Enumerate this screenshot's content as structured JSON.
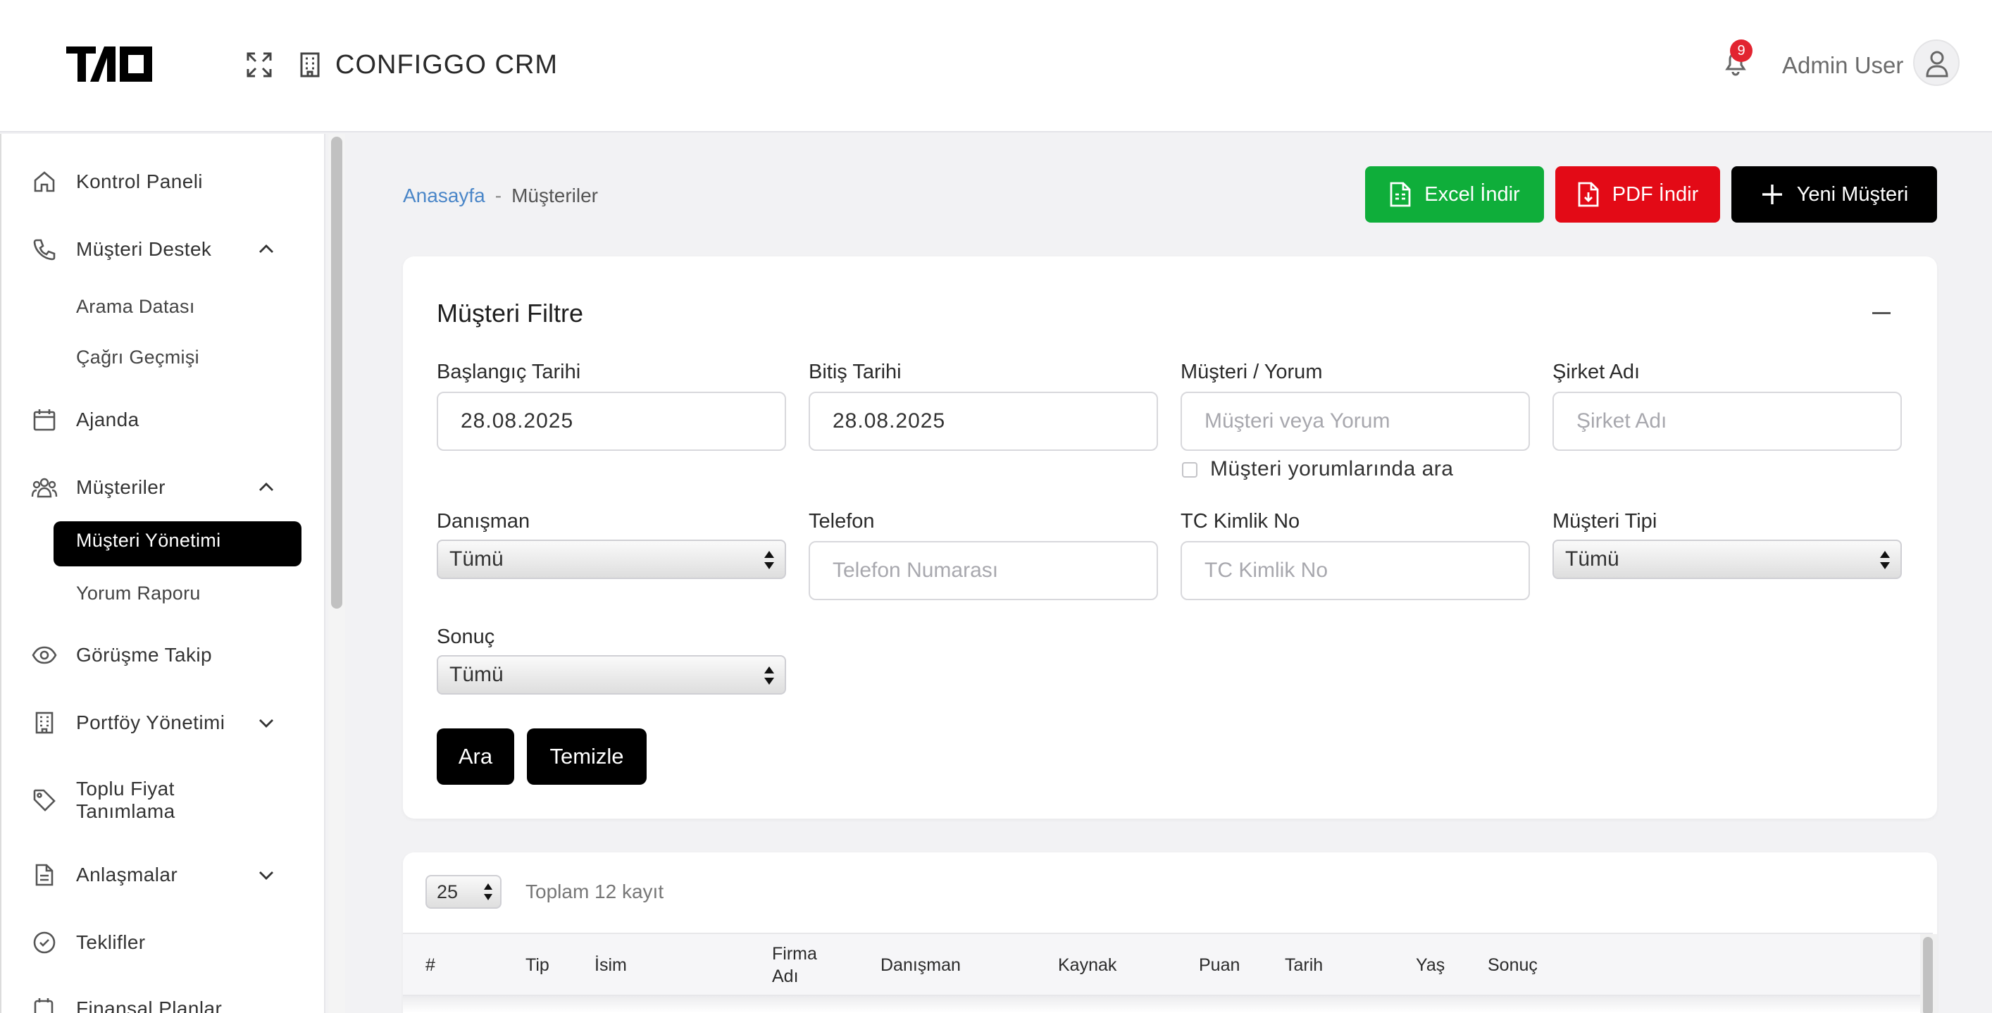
{
  "header": {
    "app_title": "CONFIGGO  CRM",
    "notification_count": "9",
    "user_name": "Admin User"
  },
  "sidebar": {
    "items": [
      {
        "label": "Kontrol Paneli",
        "icon": "home-icon"
      },
      {
        "label": "Müşteri Destek",
        "icon": "phone-icon",
        "expanded": true
      },
      {
        "label": "Ajanda",
        "icon": "calendar-icon"
      },
      {
        "label": "Müşteriler",
        "icon": "users-icon",
        "expanded": true
      },
      {
        "label": "Görüşme Takip",
        "icon": "eye-icon"
      },
      {
        "label": "Portföy Yönetimi",
        "icon": "building-icon",
        "expanded": false
      },
      {
        "label": "Toplu Fiyat\nTanımlama",
        "icon": "tag-icon"
      },
      {
        "label": "Anlaşmalar",
        "icon": "document-icon",
        "expanded": false
      },
      {
        "label": "Teklifler",
        "icon": "check-circle-icon"
      },
      {
        "label": "Finansal Planlar",
        "icon": "finance-icon"
      }
    ],
    "support_sub": [
      "Arama Datası",
      "Çağrı Geçmişi"
    ],
    "customers_sub": [
      "Müşteri Yönetimi",
      "Yorum Raporu"
    ],
    "active_sub": "Müşteri Yönetimi"
  },
  "breadcrumb": {
    "home": "Anasayfa",
    "separator": "-",
    "current": "Müşteriler"
  },
  "actions": {
    "excel": "Excel İndir",
    "pdf": "PDF İndir",
    "new": "Yeni Müşteri"
  },
  "filter": {
    "title": "Müşteri Filtre",
    "start_label": "Başlangıç Tarihi",
    "start_value": "28.08.2025",
    "end_label": "Bitiş Tarihi",
    "end_value": "28.08.2025",
    "customer_label": "Müşteri / Yorum",
    "customer_placeholder": "Müşteri veya Yorum",
    "search_comments_label": "Müşteri yorumlarında ara",
    "company_label": "Şirket Adı",
    "company_placeholder": "Şirket Adı",
    "consultant_label": "Danışman",
    "consultant_value": "Tümü",
    "phone_label": "Telefon",
    "phone_placeholder": "Telefon Numarası",
    "tc_label": "TC Kimlik No",
    "tc_placeholder": "TC Kimlik No",
    "type_label": "Müşteri Tipi",
    "type_value": "Tümü",
    "result_label": "Sonuç",
    "result_value": "Tümü",
    "search_btn": "Ara",
    "clear_btn": "Temizle"
  },
  "table": {
    "page_size": "25",
    "total_text": "Toplam 12 kayıt",
    "columns": [
      "#",
      "Tip",
      "İsim",
      "Firma\nAdı",
      "Danışman",
      "Kaynak",
      "Puan",
      "Tarih",
      "Yaş",
      "Sonuç"
    ]
  },
  "colors": {
    "excel": "#0fae3a",
    "pdf": "#e30a16",
    "primary": "#000000",
    "link": "#4a86c8",
    "badge": "#e22430"
  }
}
